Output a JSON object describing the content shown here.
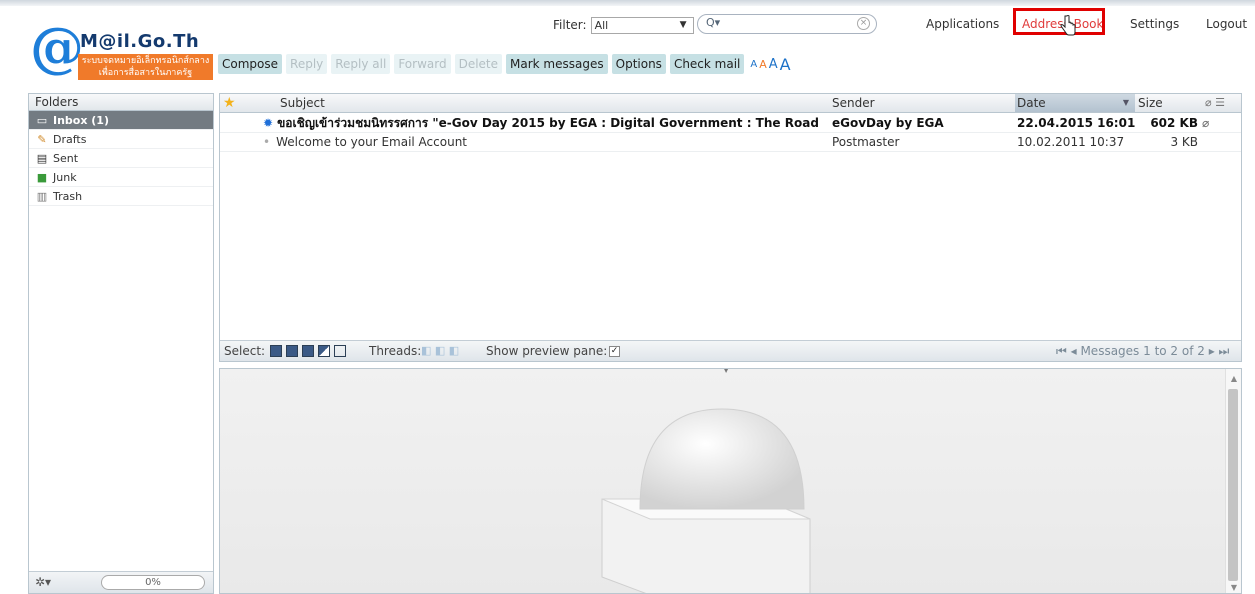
{
  "logo": {
    "name": "M@il.Go.Th",
    "tagline_line1": "ระบบจดหมายอิเล็กทรอนิกส์กลาง",
    "tagline_line2": "เพื่อการสื่อสารในภาครัฐ"
  },
  "filter": {
    "label": "Filter:",
    "value": "All"
  },
  "search": {
    "placeholder": ""
  },
  "topnav": {
    "applications": "Applications",
    "address_book": "Address Book",
    "settings": "Settings",
    "logout": "Logout"
  },
  "toolbar": {
    "compose": "Compose",
    "reply": "Reply",
    "reply_all": "Reply all",
    "forward": "Forward",
    "delete": "Delete",
    "mark": "Mark messages",
    "options": "Options",
    "check_mail": "Check mail"
  },
  "folders": {
    "header": "Folders",
    "items": [
      {
        "label": "Inbox (1)",
        "icon": "inbox-icon",
        "selected": true
      },
      {
        "label": "Drafts",
        "icon": "pencil-icon"
      },
      {
        "label": "Sent",
        "icon": "sent-icon"
      },
      {
        "label": "Junk",
        "icon": "junk-icon"
      },
      {
        "label": "Trash",
        "icon": "trash-icon"
      }
    ],
    "quota": "0%"
  },
  "list": {
    "columns": {
      "subject": "Subject",
      "sender": "Sender",
      "date": "Date",
      "size": "Size"
    },
    "rows": [
      {
        "subject": "ขอเชิญเข้าร่วมชมนิทรรศการ \"e-Gov Day 2015 by EGA : Digital Government : The Road",
        "sender": "eGovDay by EGA",
        "date": "22.04.2015 16:01",
        "size": "602 KB",
        "unread": true,
        "attachment": true
      },
      {
        "subject": "Welcome to your Email Account",
        "sender": "Postmaster",
        "date": "10.02.2011 10:37",
        "size": "3 KB",
        "unread": false,
        "attachment": false
      }
    ],
    "footer": {
      "select": "Select:",
      "threads": "Threads:",
      "preview": "Show preview pane:",
      "count": "Messages 1 to 2 of 2"
    }
  },
  "colors": {
    "accent": "#e03b3b",
    "highlight_box": "#e00000",
    "logo_orange": "#f07a2a",
    "logo_blue": "#1e7ed9"
  }
}
